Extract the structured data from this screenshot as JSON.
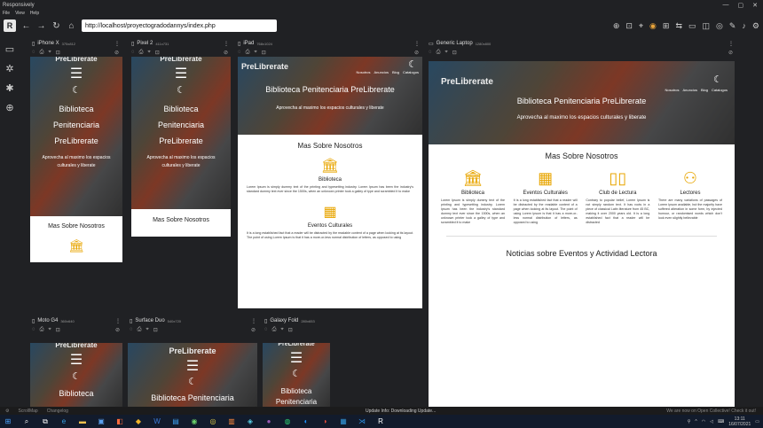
{
  "window": {
    "title": "Responsively",
    "controls": [
      "—",
      "▢",
      "✕"
    ]
  },
  "menu": [
    "File",
    "View",
    "Help"
  ],
  "toolbar": {
    "app_icon": "R",
    "url": "http://localhost/proyectogradodannys/index.php"
  },
  "site": {
    "brand": "PreLibrerate",
    "title_full": "Biblioteca Penitenciaria PreLibrerate",
    "title_word1": "Biblioteca",
    "title_word2": "Penitenciaria",
    "title_word3": "PreLibrerate",
    "subtitle": "Aprovecha al maximo los espacios culturales y liberate",
    "nav": [
      "Nosotros",
      "Anuncios",
      "Blog",
      "Catalogos"
    ],
    "section_title": "Mas Sobre Nosotros",
    "news_title": "Noticias sobre Eventos y Actividad Lectora",
    "features": [
      {
        "title": "Biblioteca",
        "text": "Lorem Ipsum is simply dummy text of the printing and typesetting industry. Lorem Ipsum has been the industry's standard dummy text ever since the 1500s, when an unknown printer took a galley of type and scrambled it to make"
      },
      {
        "title": "Eventos Culturales",
        "text": "It is a long established fact that a reader will be distracted by the readable content of a page when looking at its layout. The point of using Lorem Ipsum is that it has a more-or-less normal distribution of letters, as opposed to using"
      },
      {
        "title": "Club de Lectura",
        "text": "Contrary to popular belief, Lorem Ipsum is not simply random text. It has roots in a piece of classical Latin literature from 45 BC, making it over 2000 years old. It is a long established fact that a reader will be distracted"
      },
      {
        "title": "Lectores",
        "text": "There are many variations of passages of Lorem Ipsum available, but the majority have suffered alteration in some form, by injected humour, or randomised words which don't look even slightly believable"
      }
    ]
  },
  "devices": [
    {
      "name": "iPhone X",
      "res": "375x812"
    },
    {
      "name": "Pixel 2",
      "res": "411x731"
    },
    {
      "name": "iPad",
      "res": "768x1024"
    },
    {
      "name": "Generic Laptop",
      "res": "1280x800"
    },
    {
      "name": "Moto G4",
      "res": "360x640"
    },
    {
      "name": "Surface Duo",
      "res": "540x720"
    },
    {
      "name": "Galaxy Fold",
      "res": "280x653"
    }
  ],
  "status": {
    "left1": "ScrollMap",
    "left2": "Changelog",
    "center": "Update Info: Downloading Update...",
    "right": "We are now on Open Collective! Check it out!",
    "clock": "13:11",
    "date": "16/07/2021"
  },
  "colors": {
    "accent": "#e8a500",
    "bg": "#202124",
    "taskbar": "#121b2c"
  }
}
